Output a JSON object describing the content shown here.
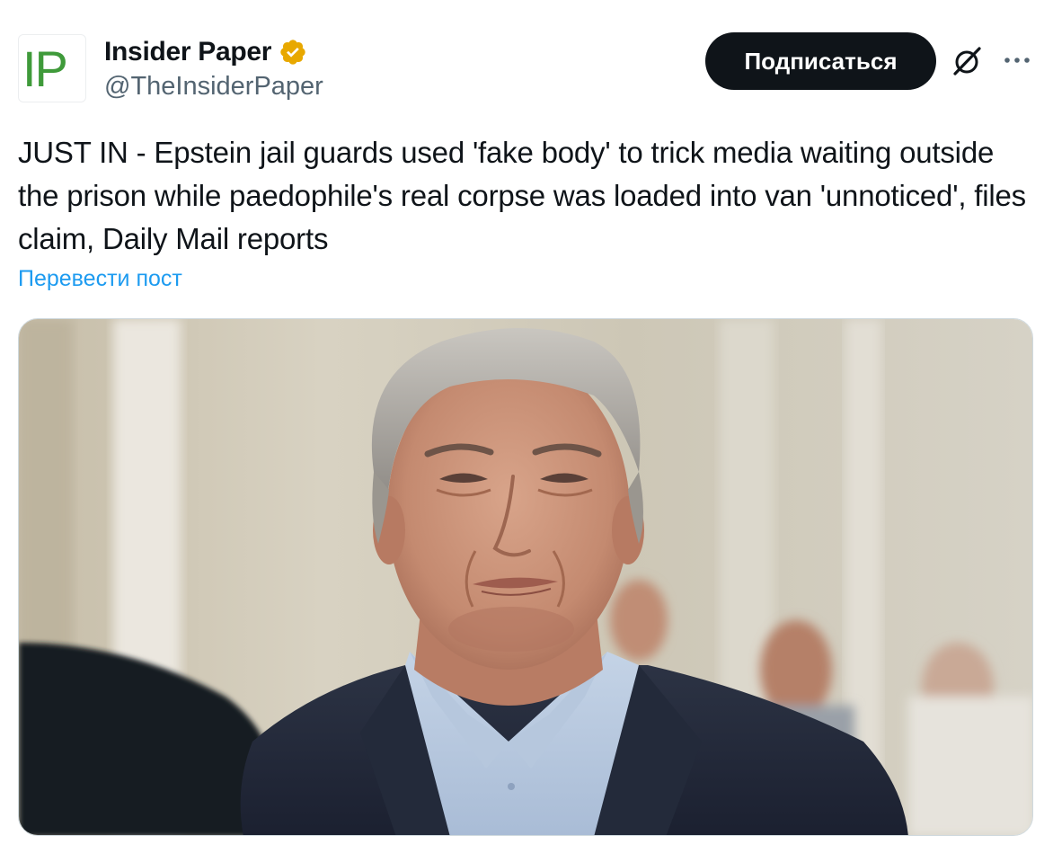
{
  "author": {
    "display_name": "Insider Paper",
    "handle": "@TheInsiderPaper",
    "avatar_text": "IP",
    "verified": true,
    "verified_color": "#f4b000"
  },
  "actions": {
    "subscribe_label": "Подписаться",
    "grok_icon": "grok-icon",
    "more_icon": "more-icon"
  },
  "post": {
    "text": "JUST IN - Epstein jail guards used 'fake body' to trick media waiting outside the prison while paedophile's real corpse was loaded into van 'unnoticed', files claim, Daily Mail reports",
    "translate_label": "Перевести пост"
  },
  "media": {
    "type": "photo",
    "description_icon": "photo-of-man-in-suit"
  },
  "colors": {
    "text": "#0f1419",
    "secondary": "#536471",
    "link": "#1d9bf0",
    "button_bg": "#0f1419",
    "logo_green": "#3f9a3a"
  }
}
